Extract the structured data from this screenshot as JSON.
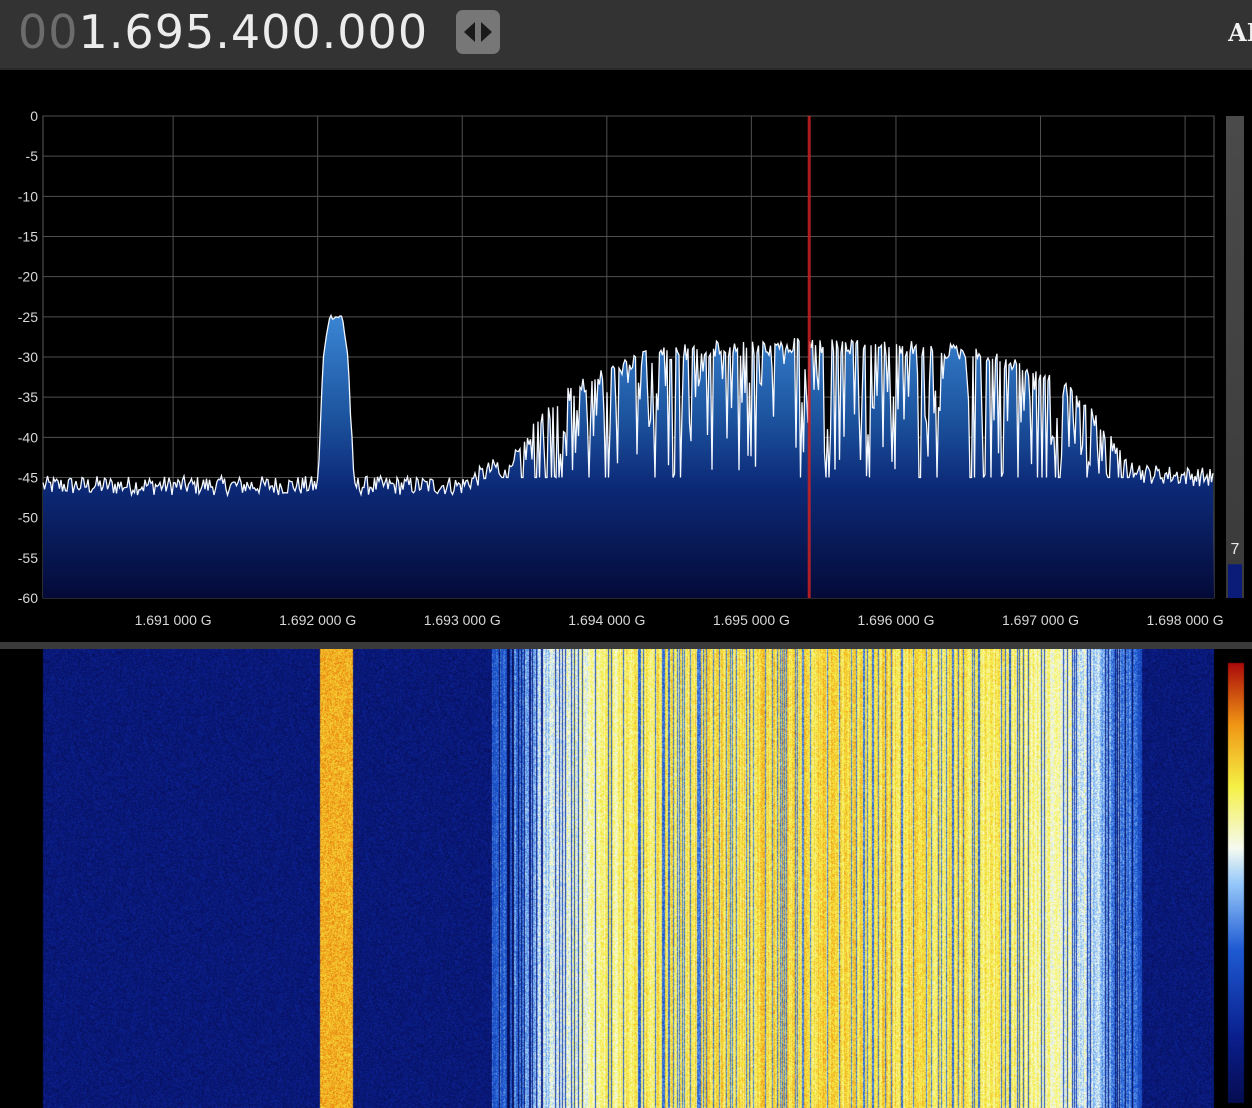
{
  "frequency": {
    "leading": "00",
    "main": "1.695.400.000"
  },
  "right_label": "AI",
  "icons": {
    "tune_button": "left-right-arrows-icon"
  },
  "colors": {
    "background": "#000000",
    "toolbar": "#333333",
    "grid": "#555555",
    "trace": "#f4f8ff",
    "fill_top": "#2f74c0",
    "fill_bottom": "#040a38",
    "center_marker": "#cc2222"
  },
  "level_scale": {
    "value_label": "7",
    "fill_fraction": 0.07
  },
  "chart_data": {
    "type": "area",
    "title": "",
    "xlabel": "",
    "ylabel": "",
    "x_unit": "G",
    "y_unit": "dB",
    "xlim": [
      1.6901,
      1.6982
    ],
    "ylim": [
      -60,
      0
    ],
    "grid": true,
    "yticks": [
      0,
      -5,
      -10,
      -15,
      -20,
      -25,
      -30,
      -35,
      -40,
      -45,
      -50,
      -55,
      -60
    ],
    "ytick_labels": [
      "0",
      "-5",
      "-10",
      "-15",
      "-20",
      "-25",
      "-30",
      "-35",
      "-40",
      "-45",
      "-50",
      "-55",
      "-60"
    ],
    "xticks": [
      1.691,
      1.692,
      1.693,
      1.694,
      1.695,
      1.696,
      1.697,
      1.698
    ],
    "xtick_labels": [
      "1.691 000 G",
      "1.692 000 G",
      "1.693 000 G",
      "1.694 000 G",
      "1.695 000 G",
      "1.696 000 G",
      "1.697 000 G",
      "1.698 000 G"
    ],
    "center_frequency": 1.6954,
    "noise_floor": -46,
    "signals": [
      {
        "start": 1.69203,
        "end": 1.69222,
        "peak": -25,
        "kind": "narrow carrier"
      },
      {
        "start": 1.6932,
        "end": 1.6977,
        "peak": -27.5,
        "kind": "wideband modulated signal"
      }
    ],
    "series": [
      {
        "x": [
          1.6901,
          1.6915,
          1.692,
          1.69204,
          1.69208,
          1.69217,
          1.69221,
          1.69225,
          1.693,
          1.6933,
          1.6935,
          1.6937,
          1.694,
          1.6943,
          1.6947,
          1.695,
          1.6954,
          1.6958,
          1.6962,
          1.6965,
          1.6968,
          1.6971,
          1.6973,
          1.6975,
          1.6977,
          1.6982
        ],
        "y": [
          -46,
          -46,
          -46,
          -30,
          -25,
          -25,
          -30,
          -46,
          -46,
          -43,
          -38,
          -34,
          -31,
          -29,
          -28,
          -28,
          -27.5,
          -28,
          -28,
          -28.5,
          -30,
          -32,
          -35,
          -40,
          -44.5,
          -45
        ]
      }
    ]
  }
}
